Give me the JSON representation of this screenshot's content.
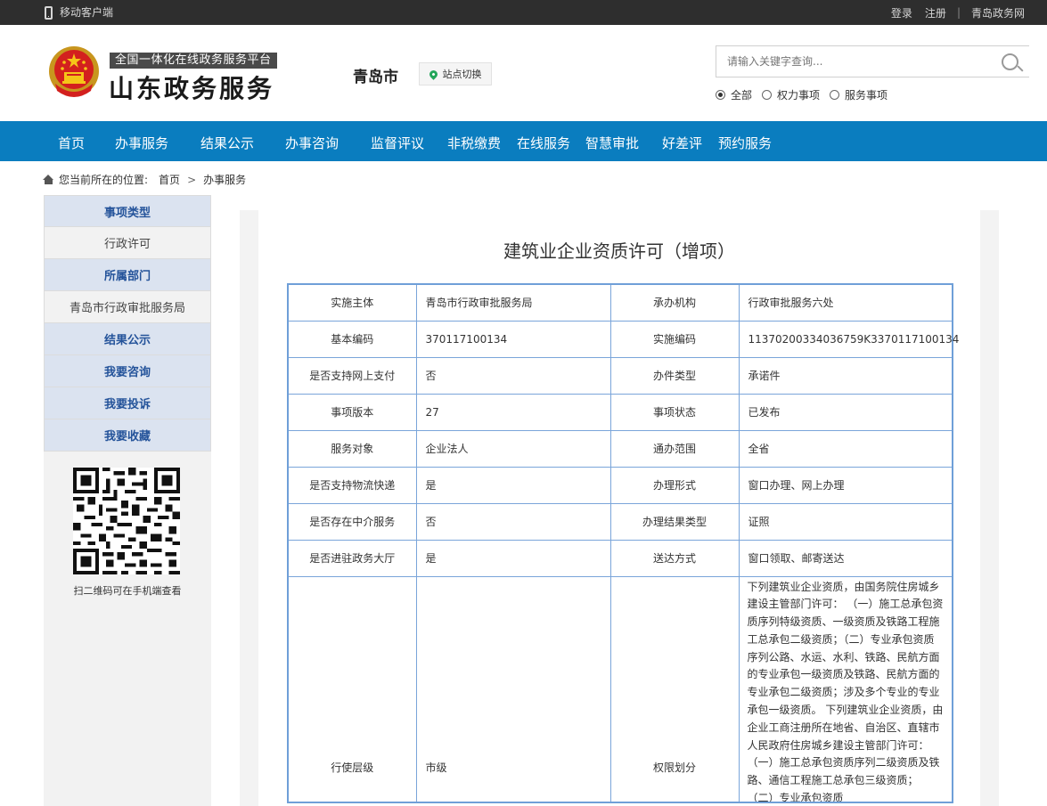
{
  "topbar": {
    "mobile_label": "移动客户端",
    "login": "登录",
    "register": "注册",
    "sep": "|",
    "site_link": "青岛政务网"
  },
  "header": {
    "slogan": "全国一体化在线政务服务平台",
    "brand": "山东政务服务",
    "city": "青岛市",
    "switch_label": "站点切换",
    "search_placeholder": "请输入关键字查询...",
    "radio_options": [
      "全部",
      "权力事项",
      "服务事项"
    ],
    "radio_selected": "全部"
  },
  "nav": {
    "items": [
      "首页",
      "办事服务",
      "结果公示",
      "办事咨询",
      "监督评议",
      "非税缴费",
      "在线服务",
      "智慧审批",
      "好差评",
      "预约服务"
    ]
  },
  "breadcrumb": {
    "prefix": "您当前所在的位置:",
    "items": [
      "首页",
      "办事服务"
    ],
    "sep": ">"
  },
  "sidebar": {
    "rows": [
      {
        "label": "事项类型",
        "kind": "head"
      },
      {
        "label": "行政许可",
        "kind": "sub"
      },
      {
        "label": "所属部门",
        "kind": "head"
      },
      {
        "label": "青岛市行政审批服务局",
        "kind": "sub"
      },
      {
        "label": "结果公示",
        "kind": "head"
      },
      {
        "label": "我要咨询",
        "kind": "head"
      },
      {
        "label": "我要投诉",
        "kind": "head"
      },
      {
        "label": "我要收藏",
        "kind": "head"
      }
    ],
    "qr_caption": "扫二维码可在手机端查看"
  },
  "main": {
    "title": "建筑业企业资质许可（增项）",
    "rows": [
      [
        "实施主体",
        "青岛市行政审批服务局",
        "承办机构",
        "行政审批服务六处"
      ],
      [
        "基本编码",
        "370117100134",
        "实施编码",
        "11370200334036759K3370117100134"
      ],
      [
        "是否支持网上支付",
        "否",
        "办件类型",
        "承诺件"
      ],
      [
        "事项版本",
        "27",
        "事项状态",
        "已发布"
      ],
      [
        "服务对象",
        "企业法人",
        "通办范围",
        "全省"
      ],
      [
        "是否支持物流快递",
        "是",
        "办理形式",
        "窗口办理、网上办理"
      ],
      [
        "是否存在中介服务",
        "否",
        "办理结果类型",
        "证照"
      ],
      [
        "是否进驻政务大厅",
        "是",
        "送达方式",
        "窗口领取、邮寄送达"
      ]
    ],
    "last_row": {
      "label1": "行使层级",
      "value1": "市级",
      "label2": "权限划分",
      "value2": "下列建筑业企业资质，由国务院住房城乡建设主管部门许可： （一）施工总承包资质序列特级资质、一级资质及铁路工程施工总承包二级资质；（二）专业承包资质序列公路、水运、水利、铁路、民航方面的专业承包一级资质及铁路、民航方面的专业承包二级资质；涉及多个专业的专业承包一级资质。 下列建筑业企业资质，由企业工商注册所在地省、自治区、直辖市人民政府住房城乡建设主管部门许可： （一）施工总承包资质序列二级资质及铁路、通信工程施工总承包三级资质； （二）专业承包资质"
    }
  }
}
